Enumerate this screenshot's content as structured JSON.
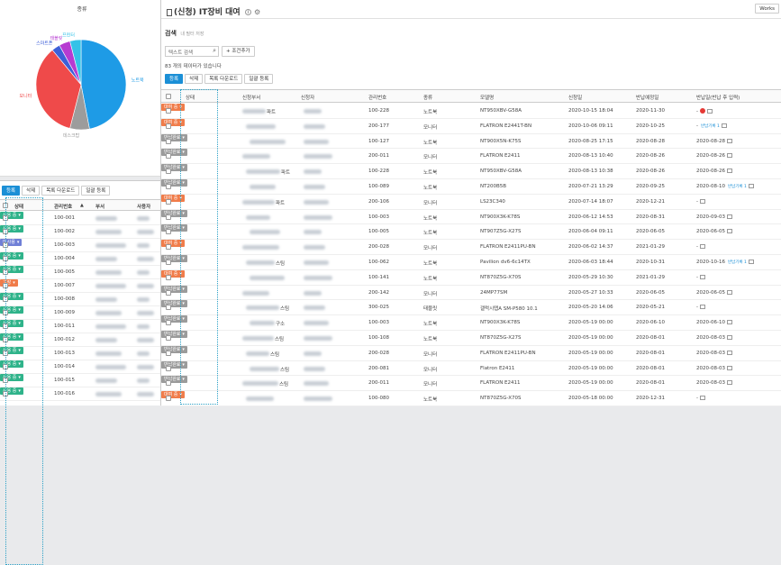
{
  "pie": {
    "title": "종류",
    "chart_data": {
      "type": "pie",
      "categories": [
        "노트북",
        "데스크탑",
        "모니터",
        "스마트폰",
        "태블릿",
        "프린터"
      ],
      "values": [
        47,
        7,
        35,
        3,
        4,
        4
      ],
      "colors": [
        "#1e9be6",
        "#9c9c9c",
        "#ef4a4a",
        "#3d5fd8",
        "#b63bd1",
        "#33c2e8"
      ]
    }
  },
  "left": {
    "toolbar": [
      "등록",
      "삭제",
      "목록 다운로드",
      "일괄 등록"
    ],
    "columns": [
      "상태",
      "관리번호",
      "부서",
      "사용자"
    ],
    "sort_arrow": "▲",
    "rows": [
      {
        "status": "사용 중",
        "id": "100-001",
        "color": "#2fb38a"
      },
      {
        "status": "사용 중",
        "id": "100-002",
        "color": "#2fb38a"
      },
      {
        "status": "미사용",
        "id": "100-003",
        "color": "#6f7fd6"
      },
      {
        "status": "사용 중",
        "id": "100-004",
        "color": "#2fb38a"
      },
      {
        "status": "사용 중",
        "id": "100-005",
        "color": "#2fb38a"
      },
      {
        "status": "고장",
        "id": "100-007",
        "color": "#f07c4a"
      },
      {
        "status": "사용 중",
        "id": "100-008",
        "color": "#2fb38a"
      },
      {
        "status": "사용 중",
        "id": "100-009",
        "color": "#2fb38a"
      },
      {
        "status": "사용 중",
        "id": "100-011",
        "color": "#2fb38a"
      },
      {
        "status": "사용 중",
        "id": "100-012",
        "color": "#2fb38a"
      },
      {
        "status": "사용 중",
        "id": "100-013",
        "color": "#2fb38a"
      },
      {
        "status": "사용 중",
        "id": "100-014",
        "color": "#2fb38a"
      },
      {
        "status": "사용 중",
        "id": "100-015",
        "color": "#2fb38a"
      },
      {
        "status": "사용 중",
        "id": "100-016",
        "color": "#2fb38a"
      }
    ]
  },
  "main": {
    "title": "(신청) IT장비 대여",
    "workspace_btn": "Works",
    "search_title": "검색",
    "search_link": "내 필터 저장",
    "search_placeholder": "텍스트 검색",
    "add_condition": "+ 조건추가",
    "count_text": "83 개의 데이터가 있습니다",
    "toolbar": [
      "등록",
      "삭제",
      "목록 다운로드",
      "일괄 등록"
    ],
    "columns": [
      "상태",
      "신청부서",
      "신청자",
      "관리번호",
      "종류",
      "모델명",
      "신청일",
      "반납예정일",
      "반납일(반납 후 입력)"
    ],
    "status_colors": {
      "rent": "#f07c4a",
      "return": "#9b9b9b"
    },
    "rows": [
      {
        "status": "대여 중",
        "dept": "파트",
        "id": "100-228",
        "type": "노트북",
        "model": "NT950XBV-G58A",
        "date": "2020-10-15 18:04",
        "due": "2020-11-30",
        "ret": "",
        "reddot": true,
        "extra": ""
      },
      {
        "status": "대여 중",
        "dept": "",
        "id": "200-177",
        "type": "모니터",
        "model": "FLATRON E2441T-BN",
        "date": "2020-10-06 09:11",
        "due": "2020-10-25",
        "ret": "",
        "reddot": false,
        "extra": "반납기록 1"
      },
      {
        "status": "반납완료",
        "dept": "",
        "id": "100-127",
        "type": "노트북",
        "model": "NT900X5N-K75S",
        "date": "2020-08-25 17:15",
        "due": "2020-08-28",
        "ret": "2020-08-28",
        "reddot": false,
        "extra": ""
      },
      {
        "status": "반납완료",
        "dept": "",
        "id": "200-011",
        "type": "모니터",
        "model": "FLATRON E2411",
        "date": "2020-08-13 10:40",
        "due": "2020-08-26",
        "ret": "2020-08-26",
        "reddot": false,
        "extra": ""
      },
      {
        "status": "반납완료",
        "dept": "파트",
        "id": "100-228",
        "type": "노트북",
        "model": "NT950XBV-G58A",
        "date": "2020-08-13 10:38",
        "due": "2020-08-26",
        "ret": "2020-08-26",
        "reddot": false,
        "extra": ""
      },
      {
        "status": "반납완료",
        "dept": "",
        "id": "100-089",
        "type": "노트북",
        "model": "NT200B5B",
        "date": "2020-07-21 13:29",
        "due": "2020-09-25",
        "ret": "2020-08-10",
        "reddot": false,
        "extra": "반납기록 1"
      },
      {
        "status": "대여 중",
        "dept": "파트",
        "id": "200-106",
        "type": "모니터",
        "model": "LS23C340",
        "date": "2020-07-14 18:07",
        "due": "2020-12-21",
        "ret": "",
        "reddot": false,
        "extra": ""
      },
      {
        "status": "반납완료",
        "dept": "",
        "id": "100-003",
        "type": "노트북",
        "model": "NT900X3K-K78S",
        "date": "2020-06-12 14:53",
        "due": "2020-08-31",
        "ret": "2020-09-03",
        "reddot": false,
        "extra": ""
      },
      {
        "status": "반납완료",
        "dept": "",
        "id": "100-005",
        "type": "노트북",
        "model": "NT907Z5G-X27S",
        "date": "2020-06-04 09:11",
        "due": "2020-06-05",
        "ret": "2020-06-05",
        "reddot": false,
        "extra": ""
      },
      {
        "status": "대여 중",
        "dept": "",
        "id": "200-028",
        "type": "모니터",
        "model": "FLATRON E2411PU-BN",
        "date": "2020-06-02 14:37",
        "due": "2021-01-29",
        "ret": "",
        "reddot": false,
        "extra": ""
      },
      {
        "status": "반납완료",
        "dept": "스팀",
        "id": "100-062",
        "type": "노트북",
        "model": "Pavilion dv6-6c14TX",
        "date": "2020-06-03 18:44",
        "due": "2020-10-31",
        "ret": "2020-10-16",
        "reddot": false,
        "extra": "반납기록 1"
      },
      {
        "status": "대여 중",
        "dept": "",
        "id": "100-141",
        "type": "노트북",
        "model": "NT870Z5G-X70S",
        "date": "2020-05-29 10:30",
        "due": "2021-01-29",
        "ret": "",
        "reddot": false,
        "extra": ""
      },
      {
        "status": "반납완료",
        "dept": "",
        "id": "200-142",
        "type": "모니터",
        "model": "24MP77SM",
        "date": "2020-05-27 10:33",
        "due": "2020-06-05",
        "ret": "2020-06-05",
        "reddot": false,
        "extra": ""
      },
      {
        "status": "반납완료",
        "dept": "스팀",
        "id": "300-025",
        "type": "태블릿",
        "model": "갤럭시탭A SM-P580 10.1",
        "date": "2020-05-20 14:06",
        "due": "2020-05-21",
        "ret": "",
        "reddot": false,
        "extra": ""
      },
      {
        "status": "반납완료",
        "dept": "구소",
        "id": "100-003",
        "type": "노트북",
        "model": "NT900X3K-K78S",
        "date": "2020-05-19 00:00",
        "due": "2020-06-10",
        "ret": "2020-06-10",
        "reddot": false,
        "extra": ""
      },
      {
        "status": "반납완료",
        "dept": "스팀",
        "id": "100-108",
        "type": "노트북",
        "model": "NT870Z5G-X27S",
        "date": "2020-05-19 00:00",
        "due": "2020-08-01",
        "ret": "2020-08-03",
        "reddot": false,
        "extra": ""
      },
      {
        "status": "반납완료",
        "dept": "스팀",
        "id": "200-028",
        "type": "모니터",
        "model": "FLATRON E2411PU-BN",
        "date": "2020-05-19 00:00",
        "due": "2020-08-01",
        "ret": "2020-08-03",
        "reddot": false,
        "extra": ""
      },
      {
        "status": "반납완료",
        "dept": "스팀",
        "id": "200-081",
        "type": "모니터",
        "model": "Flatron E2411",
        "date": "2020-05-19 00:00",
        "due": "2020-08-01",
        "ret": "2020-08-03",
        "reddot": false,
        "extra": ""
      },
      {
        "status": "반납완료",
        "dept": "스팀",
        "id": "200-011",
        "type": "모니터",
        "model": "FLATRON E2411",
        "date": "2020-05-19 00:00",
        "due": "2020-08-01",
        "ret": "2020-08-03",
        "reddot": false,
        "extra": ""
      },
      {
        "status": "대여 중",
        "dept": "",
        "id": "100-080",
        "type": "노트북",
        "model": "NT870Z5G-X70S",
        "date": "2020-05-18 00:00",
        "due": "2020-12-31",
        "ret": "",
        "reddot": false,
        "extra": ""
      }
    ]
  }
}
